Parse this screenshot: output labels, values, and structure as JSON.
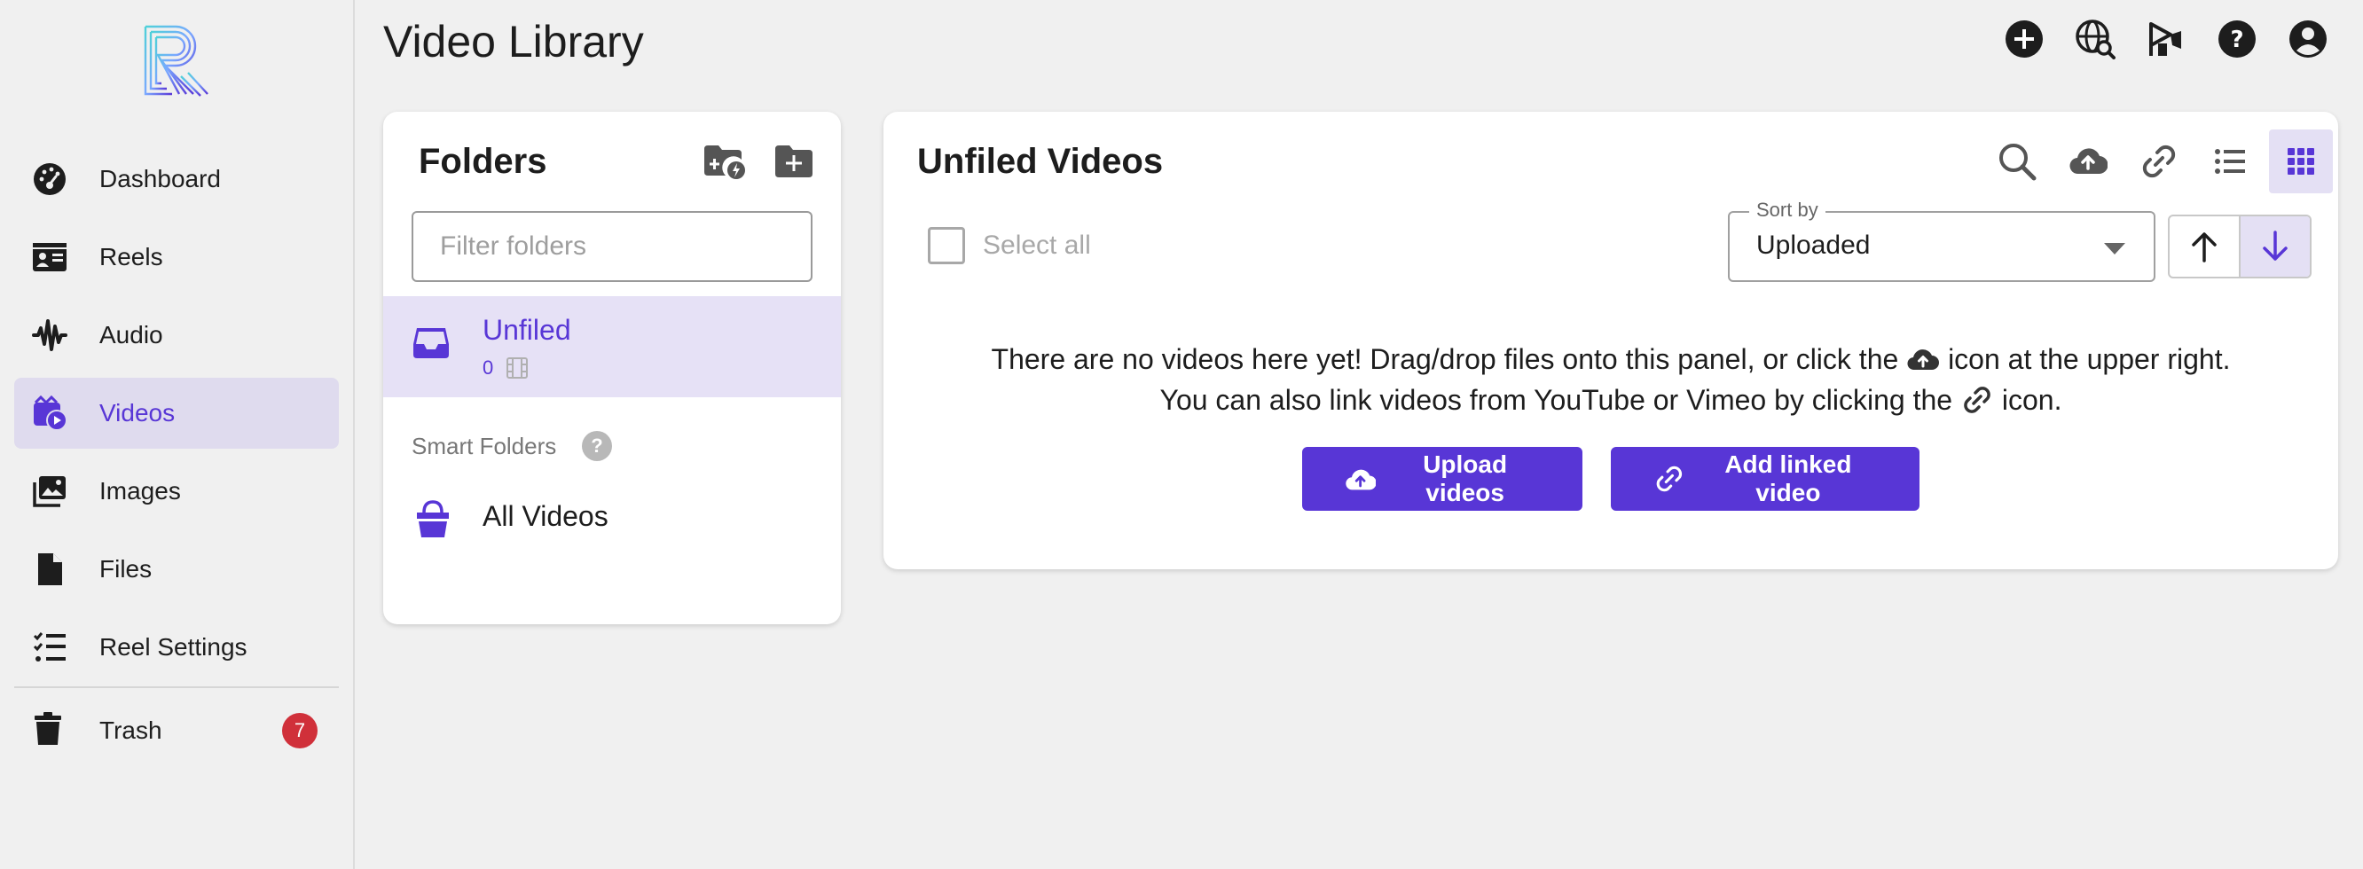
{
  "app": {
    "page_title": "Video Library"
  },
  "sidebar": {
    "items": [
      {
        "id": "dashboard",
        "label": "Dashboard",
        "icon": "gauge-icon",
        "active": false
      },
      {
        "id": "reels",
        "label": "Reels",
        "icon": "id-card-icon",
        "active": false
      },
      {
        "id": "audio",
        "label": "Audio",
        "icon": "waveform-icon",
        "active": false
      },
      {
        "id": "videos",
        "label": "Videos",
        "icon": "video-clapper-icon",
        "active": true
      },
      {
        "id": "images",
        "label": "Images",
        "icon": "images-icon",
        "active": false
      },
      {
        "id": "files",
        "label": "Files",
        "icon": "file-icon",
        "active": false
      },
      {
        "id": "reel-settings",
        "label": "Reel Settings",
        "icon": "list-check-icon",
        "active": false
      }
    ],
    "trash": {
      "label": "Trash",
      "count": "7",
      "icon": "trash-icon"
    }
  },
  "header_icons": [
    "add-circle-icon",
    "globe-search-icon",
    "announcement-icon",
    "help-circle-icon",
    "account-icon"
  ],
  "folders": {
    "title": "Folders",
    "filter_placeholder": "Filter folders",
    "unfiled": {
      "name": "Unfiled",
      "count": "0"
    },
    "smart_label": "Smart Folders",
    "smart_help": "?",
    "all_videos": "All Videos"
  },
  "videos": {
    "title": "Unfiled Videos",
    "select_all": "Select all",
    "sort_label": "Sort by",
    "sort_value": "Uploaded",
    "empty_line1_a": "There are no videos here yet! Drag/drop files onto this panel, or click the",
    "empty_line1_b": "icon at the upper right.",
    "empty_line2_a": "You can also link videos from YouTube or Vimeo by clicking the",
    "empty_line2_b": "icon.",
    "upload_button": "Upload videos",
    "linked_button": "Add linked video"
  },
  "colors": {
    "accent": "#5836d6",
    "active_bg": "#dfdbee",
    "badge": "#d0303a",
    "background": "#f0f0f0"
  }
}
